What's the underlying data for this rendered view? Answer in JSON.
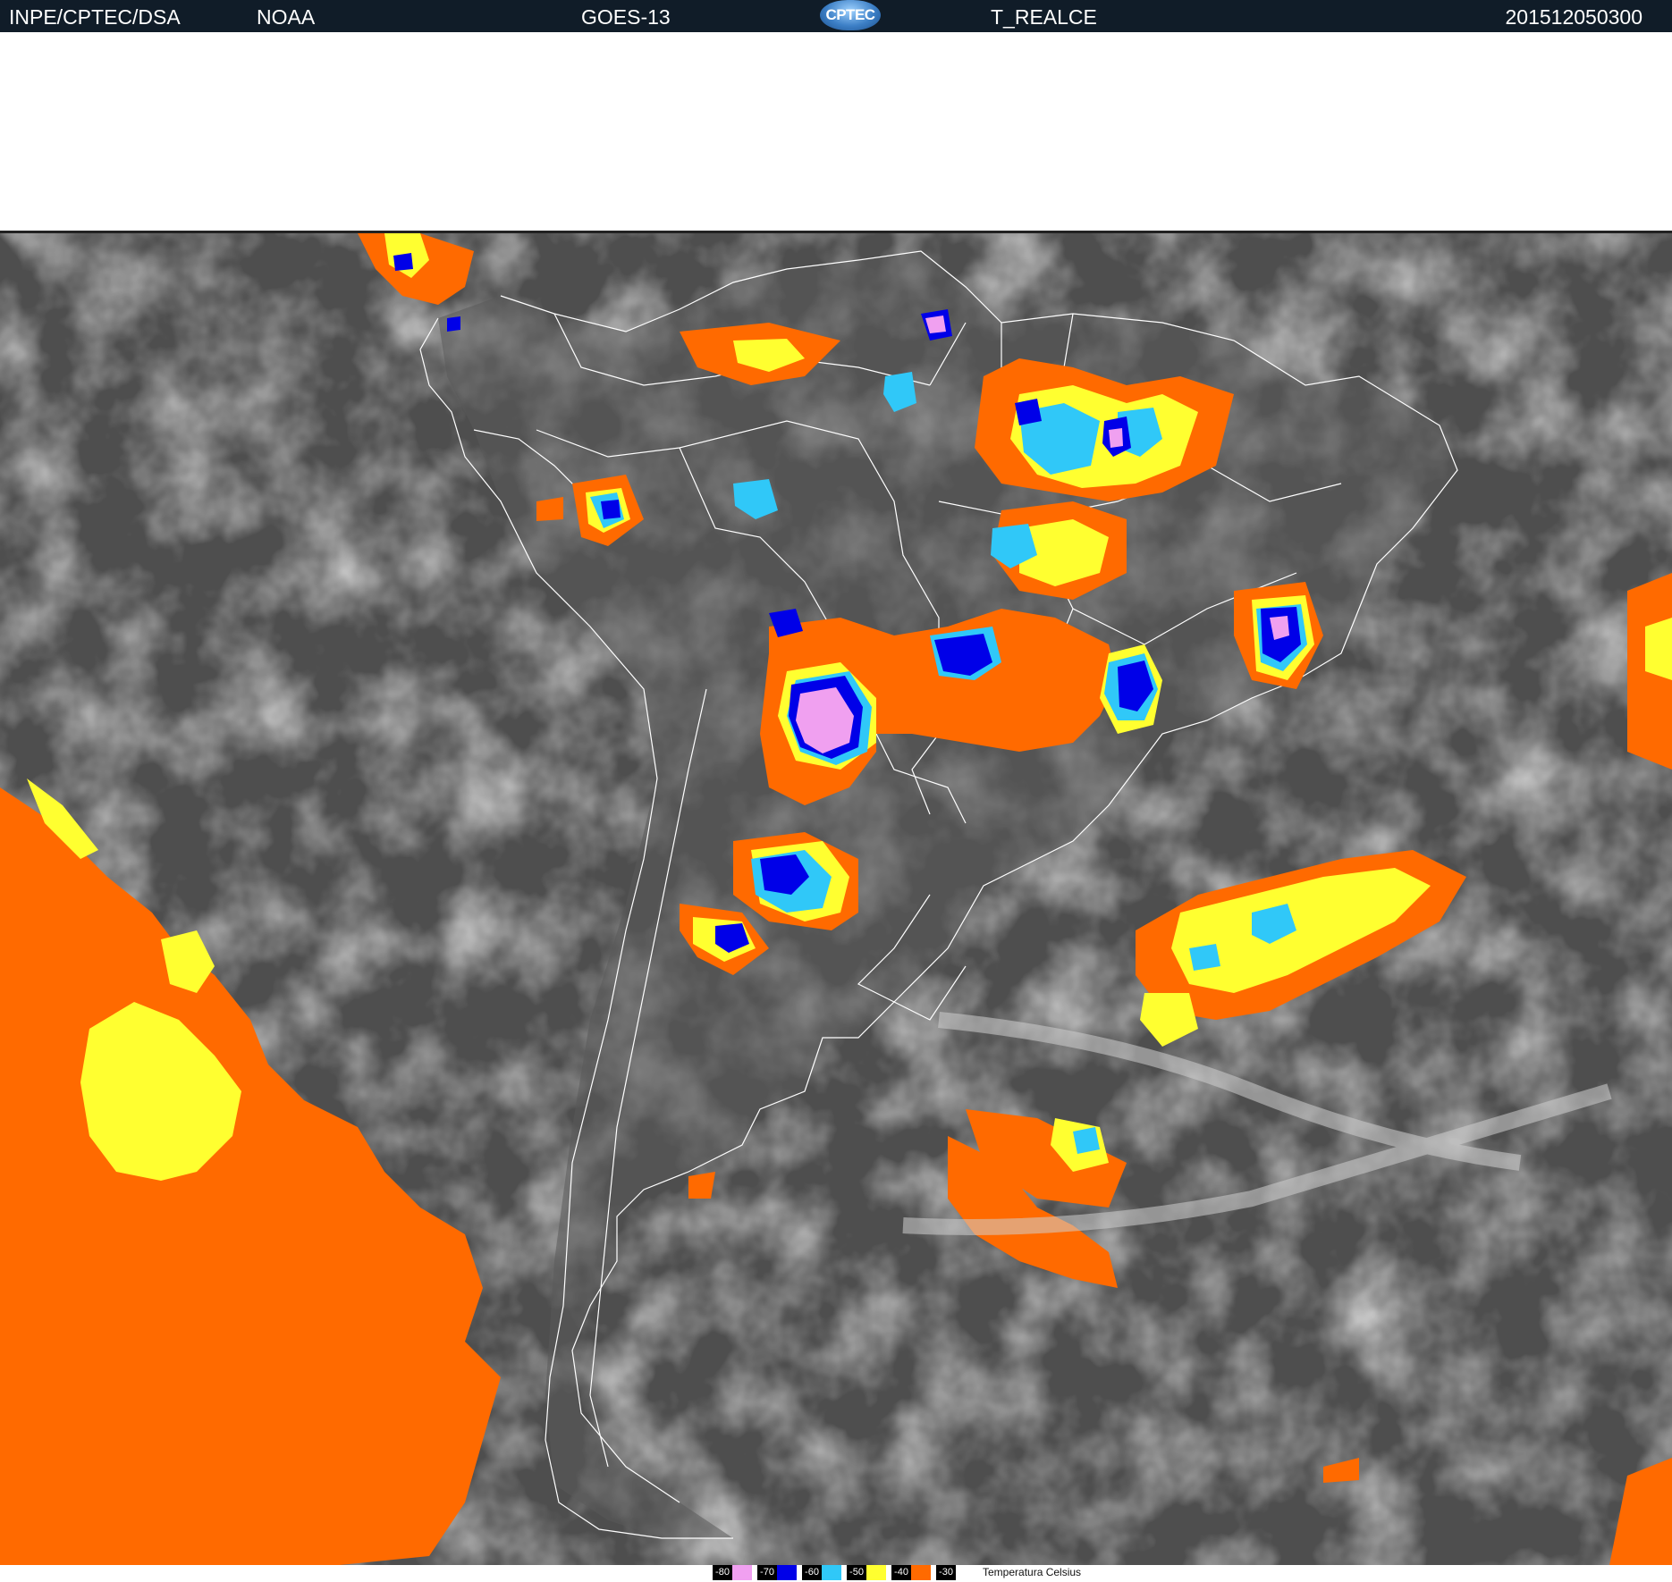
{
  "header": {
    "institution": "INPE/CPTEC/DSA",
    "agency": "NOAA",
    "satellite": "GOES-13",
    "logo_text": "CPTEC",
    "product": "T_REALCE",
    "timestamp": "201512050300"
  },
  "legend": {
    "items": [
      {
        "label": "-80",
        "color": "#f0a0f0"
      },
      {
        "label": "-70",
        "color": "#0000e8"
      },
      {
        "label": "-60",
        "color": "#30c8f8"
      },
      {
        "label": "-50",
        "color": "#ffff30"
      },
      {
        "label": "-40",
        "color": "#ff6a00"
      },
      {
        "label": "-30",
        "color": "#000000"
      }
    ],
    "caption": "Temperatura  Celsius"
  },
  "map": {
    "colors": {
      "ocean": "#4e4e4e",
      "land": "#5a5a5a",
      "cloud": "#c8c8c8",
      "coastline": "#ffffff",
      "t_minus30": "#ff6a00",
      "t_minus40": "#ffff30",
      "t_minus50": "#30c8f8",
      "t_minus60": "#0000e8",
      "t_minus70": "#f0a0f0"
    }
  }
}
